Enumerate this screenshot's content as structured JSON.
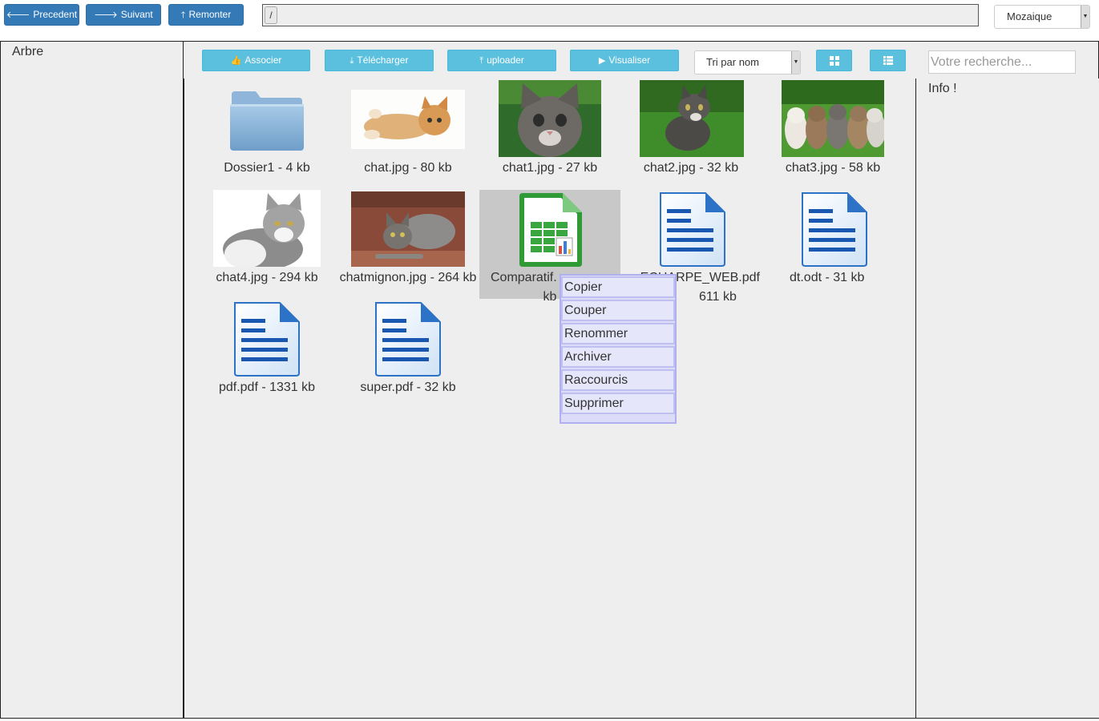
{
  "nav": {
    "previous_label": "Precedent",
    "next_label": "Suivant",
    "up_label": "Remonter",
    "path": "/",
    "view_mode": "Mozaique"
  },
  "sidebar": {
    "title": "Arbre"
  },
  "toolbar": {
    "associate_label": "Associer",
    "download_label": "Télécharger",
    "upload_label": "uploader",
    "preview_label": "Visualiser",
    "sort_label": "Tri par nom",
    "search_placeholder": "Votre recherche..."
  },
  "files": [
    {
      "name": "Dossier1 - 4 kb",
      "type": "folder"
    },
    {
      "name": "chat.jpg - 80 kb",
      "type": "image"
    },
    {
      "name": "chat1.jpg - 27 kb",
      "type": "image"
    },
    {
      "name": "chat2.jpg - 32 kb",
      "type": "image"
    },
    {
      "name": "chat3.jpg - 58 kb",
      "type": "image"
    },
    {
      "name": "chat4.jpg - 294 kb",
      "type": "image"
    },
    {
      "name": "chatmignon.jpg - 264 kb",
      "type": "image"
    },
    {
      "name": "Comparatif.",
      "size": "kb",
      "type": "spreadsheet",
      "selected": true
    },
    {
      "name": "ECHARPE_WEB.pdf",
      "size": "611 kb",
      "type": "document"
    },
    {
      "name": "dt.odt - 31 kb",
      "type": "document"
    },
    {
      "name": "pdf.pdf - 1331 kb",
      "type": "document"
    },
    {
      "name": "super.pdf - 32 kb",
      "type": "document"
    }
  ],
  "context_menu": [
    "Copier",
    "Couper",
    "Renommer",
    "Archiver",
    "Raccourcis",
    "Supprimer"
  ],
  "info": {
    "title": "Info !"
  },
  "colors": {
    "primary": "#337ab7",
    "info": "#5bc0de",
    "menu": "#e6e6fa",
    "selected": "#c8c8c8"
  }
}
